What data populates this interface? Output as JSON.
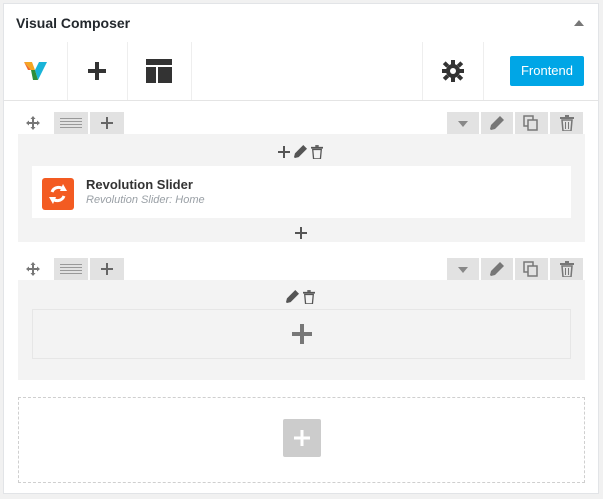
{
  "panel": {
    "title": "Visual Composer"
  },
  "toolbar": {
    "logo_icon": "visual-composer-logo",
    "add_element_icon": "plus-icon",
    "templates_icon": "layout-template-icon",
    "settings_icon": "gear-icon",
    "frontend_label": "Frontend"
  },
  "rows": [
    {
      "controls": [
        "move-icon",
        "columns-layout-icon",
        "plus-icon",
        "chevron-down-icon",
        "pencil-icon",
        "copy-icon",
        "trash-icon"
      ],
      "column_controls": [
        "plus-icon",
        "pencil-icon",
        "trash-icon"
      ],
      "element": {
        "title": "Revolution Slider",
        "subtitle": "Revolution Slider: Home",
        "icon": "refresh-icon"
      }
    },
    {
      "controls": [
        "move-icon",
        "columns-layout-icon",
        "plus-icon",
        "chevron-down-icon",
        "pencil-icon",
        "copy-icon",
        "trash-icon"
      ],
      "column_controls": [
        "pencil-icon",
        "trash-icon"
      ],
      "element": null
    }
  ],
  "colors": {
    "accent": "#00a6e6",
    "element_icon": "#f35b22"
  }
}
